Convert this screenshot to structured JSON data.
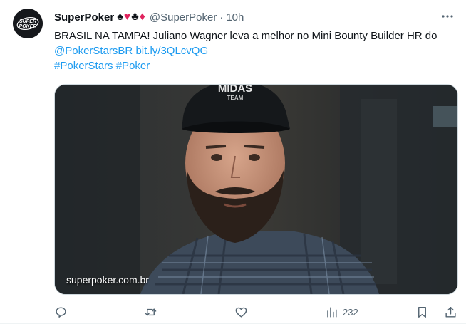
{
  "tweet": {
    "display_name": "SuperPoker",
    "suits": [
      "♠",
      "♥",
      "♣",
      "♦"
    ],
    "handle": "@SuperPoker",
    "separator": "·",
    "time": "10h",
    "text_main": "BRASIL NA TAMPA! Juliano Wagner leva a melhor no Mini Bounty Builder HR do ",
    "mention": "@PokerStarsBR",
    "link": "bit.ly/3QLcvQG",
    "hashtag_1": "#PokerStars",
    "hashtag_2": "#Poker",
    "avatar_text_1": "SUPER",
    "avatar_text_2": "POKER",
    "cap_text_1": "MIDAS",
    "cap_text_2": "TEAM",
    "media_source": "superpoker.com.br",
    "views": "232"
  },
  "colors": {
    "link": "#1d9bf0",
    "text": "#0f1419",
    "muted": "#536471",
    "heart_suit": "#e0245e"
  },
  "icons": {
    "more": "ellipsis-icon",
    "reply": "reply-icon",
    "retweet": "retweet-icon",
    "like": "heart-icon",
    "views": "analytics-icon",
    "bookmark": "bookmark-icon",
    "share": "share-icon"
  }
}
